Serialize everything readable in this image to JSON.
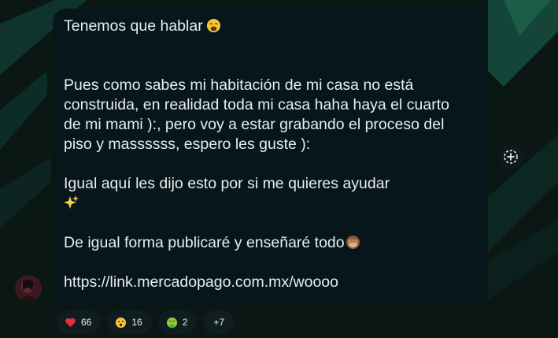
{
  "message": {
    "lines": [
      "Tenemos que hablar",
      "",
      "",
      "Pues como sabes mi habitación de mi casa no está",
      "construida, en realidad toda mi casa haha haya el cuarto",
      "de mi mami ):, pero voy a estar grabando el proceso del",
      "piso y massssss, espero les guste ):",
      "",
      "Igual aquí les dijo esto por si me quieres ayudar",
      "",
      "",
      "De igual forma publicaré y enseñaré todo",
      "",
      "https://link.mercadopago.com.mx/woooo"
    ],
    "emoji_after_title": "weary-face-emoji",
    "emoji_sparkles": "sparkles-emoji",
    "emoji_after_todo": "see-no-evil-monkey-emoji"
  },
  "reactions": [
    {
      "icon": "red-heart-emoji",
      "count": "66"
    },
    {
      "icon": "astonished-face-emoji",
      "count": "16"
    },
    {
      "icon": "vomiting-face-emoji",
      "count": "2"
    }
  ],
  "more_reactions": "+7",
  "add_reaction_icon": "add-reaction-icon",
  "colors": {
    "background": "#0a1714",
    "bubble": "#07161a",
    "text": "#e9edef",
    "accent_green": "#1f6e5a"
  }
}
